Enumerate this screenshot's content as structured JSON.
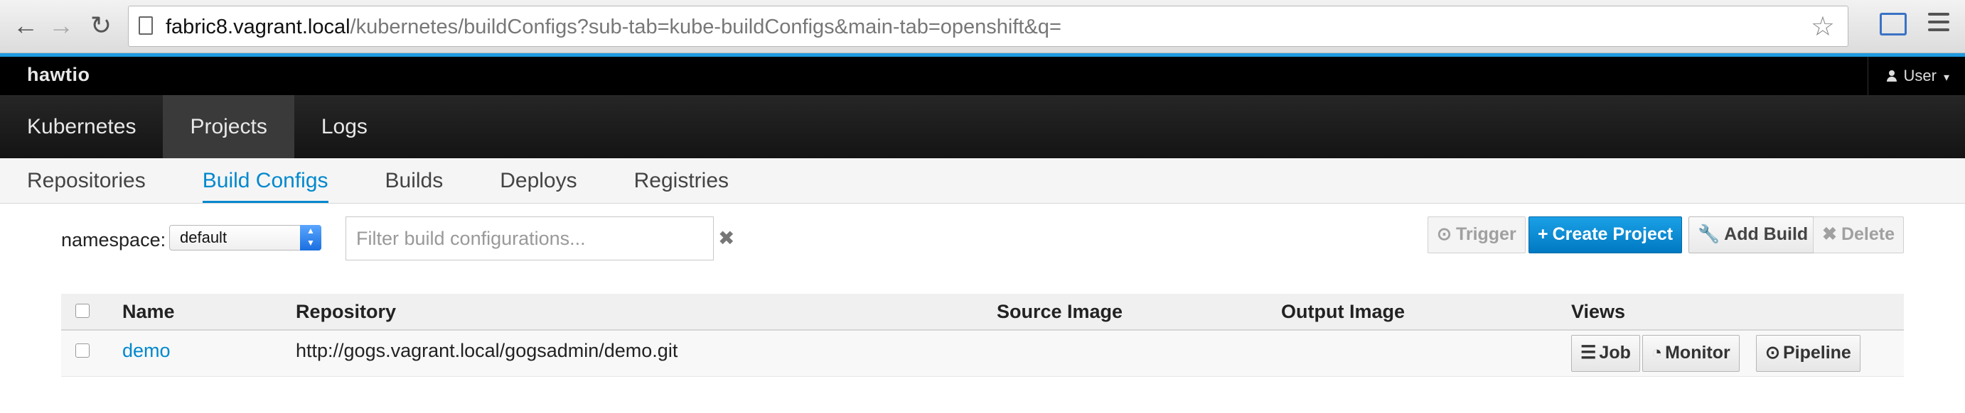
{
  "browser": {
    "back_icon": "←",
    "forward_icon": "→",
    "reload_icon": "↻",
    "url_host": "fabric8.vagrant.local",
    "url_path": "/kubernetes/buildConfigs?sub-tab=kube-buildConfigs&main-tab=openshift&q=",
    "star_icon": "☆"
  },
  "header": {
    "brand": "hawtio",
    "user_label": "User",
    "caret": "▾"
  },
  "main_nav": {
    "tabs": [
      {
        "label": "Kubernetes",
        "active": false
      },
      {
        "label": "Projects",
        "active": true
      },
      {
        "label": "Logs",
        "active": false
      }
    ]
  },
  "sub_nav": {
    "tabs": [
      {
        "label": "Repositories",
        "active": false
      },
      {
        "label": "Build Configs",
        "active": true
      },
      {
        "label": "Builds",
        "active": false
      },
      {
        "label": "Deploys",
        "active": false
      },
      {
        "label": "Registries",
        "active": false
      }
    ]
  },
  "toolbar": {
    "namespace_label": "namespace:",
    "namespace_value": "default",
    "filter_placeholder": "Filter build configurations...",
    "clear_icon": "✖",
    "trigger_label": "Trigger",
    "trigger_icon": "⊙",
    "create_label": "Create Project",
    "create_icon": "+",
    "add_build_label": "Add Build",
    "add_build_icon": "🔧",
    "delete_label": "Delete",
    "delete_icon": "✖"
  },
  "table": {
    "headers": {
      "name": "Name",
      "repository": "Repository",
      "source_image": "Source Image",
      "output_image": "Output Image",
      "views": "Views"
    },
    "rows": [
      {
        "name": "demo",
        "repository": "http://gogs.vagrant.local/gogsadmin/demo.git",
        "source_image": "",
        "output_image": "",
        "views": {
          "job_label": "Job",
          "job_icon": "☰",
          "monitor_label": "Monitor",
          "monitor_icon": "◔",
          "pipeline_label": "Pipeline",
          "pipeline_icon": "⊙"
        }
      }
    ]
  },
  "colors": {
    "accent": "#0088ce",
    "primary_button": "#0079c2",
    "header_bg": "#000000"
  }
}
